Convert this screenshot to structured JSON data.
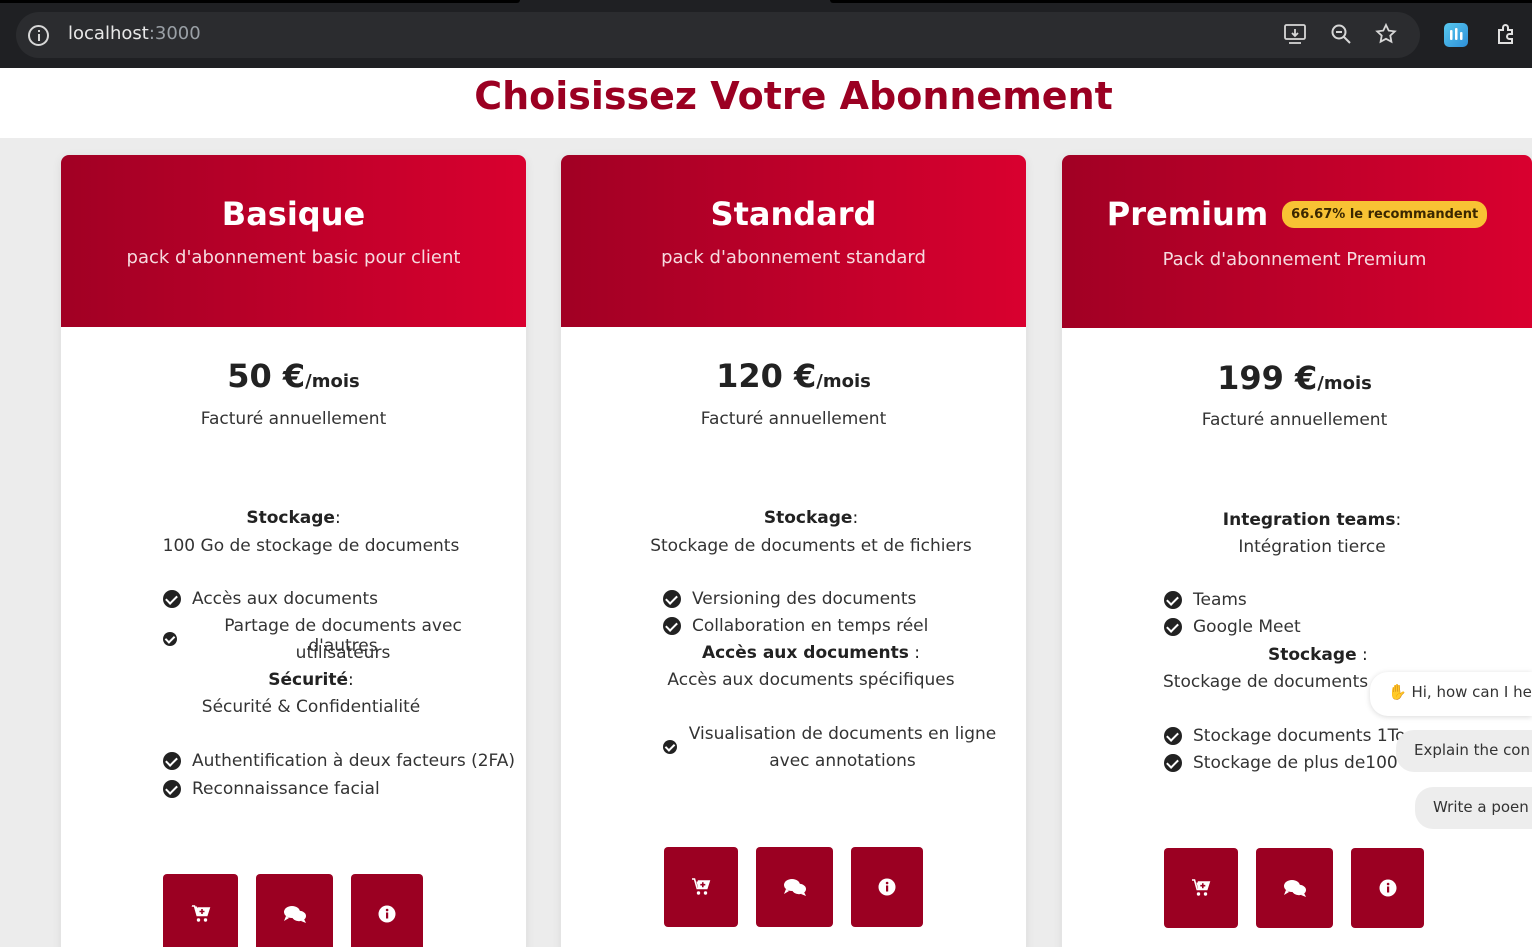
{
  "browser": {
    "url_host": "localhost",
    "url_port": ":3000",
    "icons": [
      "info-icon",
      "install-icon",
      "zoom-icon",
      "bookmark-star-icon",
      "extension-music-icon",
      "extensions-puzzle-icon"
    ]
  },
  "page": {
    "title": "Choisissez Votre Abonnement",
    "accent_color": "#9b0022",
    "gradient": [
      "#a10024",
      "#d9002f"
    ]
  },
  "plans": [
    {
      "name": "Basique",
      "description": "pack d'abonnement basic pour client",
      "price": "50 €",
      "period": "/mois",
      "billing": "Facturé annuellement",
      "stockage_title": "Stockage",
      "stockage_text": "100 Go de stockage de documents",
      "features_a": [
        "Accès aux documents",
        "Partage de documents avec d'autres",
        "utilisateurs"
      ],
      "securite_title": "Sécurité",
      "securite_text": "Sécurité & Confidentialité",
      "features_b": [
        "Authentification à deux facteurs (2FA)",
        "Reconnaissance facial"
      ]
    },
    {
      "name": "Standard",
      "description": "pack d'abonnement standard",
      "price": "120 €",
      "period": "/mois",
      "billing": "Facturé annuellement",
      "stockage_title": "Stockage",
      "stockage_text": "Stockage de documents et de fichiers",
      "features_a": [
        "Versioning des documents",
        "Collaboration en temps réel"
      ],
      "acces_title": "Accès aux documents",
      "acces_text": "Accès aux documents spécifiques",
      "features_b": [
        "Visualisation de documents en ligne",
        "avec annotations"
      ]
    },
    {
      "name": "Premium",
      "badge": "66.67% le recommandent",
      "description": "Pack d'abonnement Premium",
      "price": "199 €",
      "period": "/mois",
      "billing": "Facturé annuellement",
      "integration_title": "Integration teams",
      "integration_text": "Intégration tierce",
      "features_a": [
        "Teams",
        "Google Meet"
      ],
      "stockage_title": "Stockage",
      "stockage_text": "Stockage de documents e",
      "features_b": [
        "Stockage documents 1To",
        "Stockage de plus de100 d"
      ]
    }
  ],
  "actions": {
    "icons": [
      "cart-plus-icon",
      "comments-icon",
      "info-circle-icon"
    ]
  },
  "chat": {
    "greeting": "Hi, how can I he",
    "suggestion_1": "Explain the con",
    "suggestion_2": "Write a poen"
  }
}
